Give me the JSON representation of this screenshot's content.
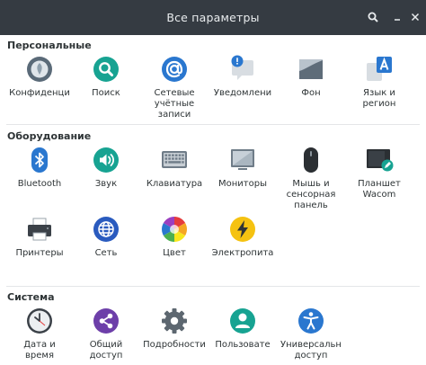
{
  "window": {
    "title": "Все параметры"
  },
  "sections": {
    "personal": {
      "title": "Персональные",
      "items": [
        {
          "label": "Конфиденци",
          "icon": "privacy-icon"
        },
        {
          "label": "Поиск",
          "icon": "search-icon"
        },
        {
          "label": "Сетевые\nучётные\nзаписи",
          "icon": "online-accounts-icon"
        },
        {
          "label": "Уведомлени",
          "icon": "notifications-icon"
        },
        {
          "label": "Фон",
          "icon": "background-icon"
        },
        {
          "label": "Язык и\nрегион",
          "icon": "language-icon"
        }
      ]
    },
    "hardware": {
      "title": "Оборудование",
      "items": [
        {
          "label": "Bluetooth",
          "icon": "bluetooth-icon"
        },
        {
          "label": "Звук",
          "icon": "sound-icon"
        },
        {
          "label": "Клавиатура",
          "icon": "keyboard-icon"
        },
        {
          "label": "Мониторы",
          "icon": "display-icon"
        },
        {
          "label": "Мышь и\nсенсорная\nпанель",
          "icon": "mouse-icon"
        },
        {
          "label": "Планшет\nWacom",
          "icon": "wacom-tablet-icon"
        },
        {
          "label": "Принтеры",
          "icon": "printer-icon"
        },
        {
          "label": "Сеть",
          "icon": "network-icon"
        },
        {
          "label": "Цвет",
          "icon": "color-icon"
        },
        {
          "label": "Электропита",
          "icon": "power-icon"
        }
      ]
    },
    "system": {
      "title": "Система",
      "items": [
        {
          "label": "Дата и\nвремя",
          "icon": "clock-icon"
        },
        {
          "label": "Общий\nдоступ",
          "icon": "sharing-icon"
        },
        {
          "label": "Подробности",
          "icon": "gear-icon"
        },
        {
          "label": "Пользовате",
          "icon": "user-icon"
        },
        {
          "label": "Универсальн\nдоступ",
          "icon": "accessibility-icon"
        }
      ]
    }
  },
  "colors": {
    "titlebar": "#353b42",
    "teal": "#17a392",
    "blue": "#2a77cf",
    "purple": "#6d3fa9"
  }
}
